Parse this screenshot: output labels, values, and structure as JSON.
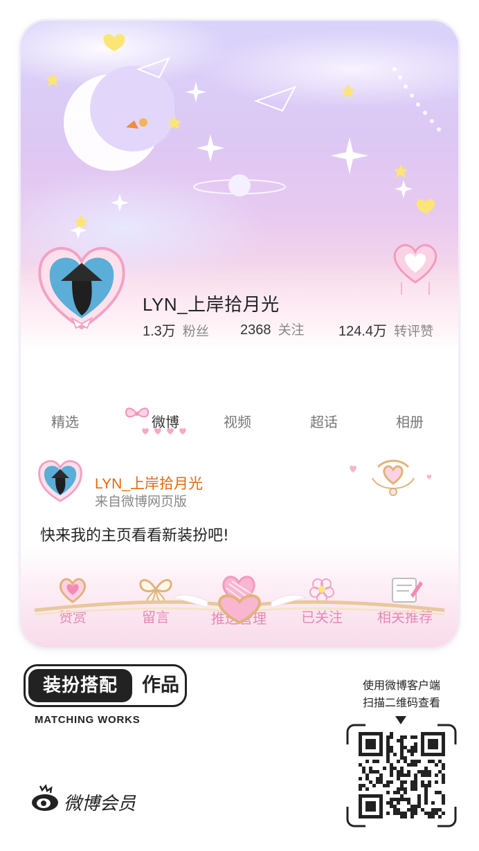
{
  "profile": {
    "name": "LYN_上岸拾月光",
    "stats": [
      {
        "value": "1.3万",
        "label": "粉丝"
      },
      {
        "value": "2368",
        "label": "关注"
      },
      {
        "value": "124.4万",
        "label": "转评赞"
      }
    ]
  },
  "tabs": [
    "精选",
    "微博",
    "视频",
    "超话",
    "相册"
  ],
  "active_tab": "微博",
  "post": {
    "author": "LYN_上岸拾月光",
    "source": "来自微博网页版",
    "text": "快来我的主页看看新装扮吧!"
  },
  "actions": [
    "赞赏",
    "留言",
    "推送管理",
    "已关注",
    "相关推荐"
  ],
  "footer": {
    "badge_left": "装扮搭配",
    "badge_right": "作品",
    "badge_sub": "MATCHING WORKS",
    "brand": "微博会员",
    "qr_tip_line1": "使用微博客户端",
    "qr_tip_line2": "扫描二维码查看"
  },
  "colors": {
    "author": "#e06a10",
    "action_label": "#e788b5",
    "banner_top": "#d9d4fb",
    "banner_bottom": "#fbe8f0"
  },
  "icons": [
    "moon-icon",
    "heart-frame-icon",
    "bow-icon",
    "wing-heart-icon",
    "flower-icon",
    "note-icon",
    "butterfly-icon",
    "weibo-eye-icon",
    "qr-code"
  ]
}
